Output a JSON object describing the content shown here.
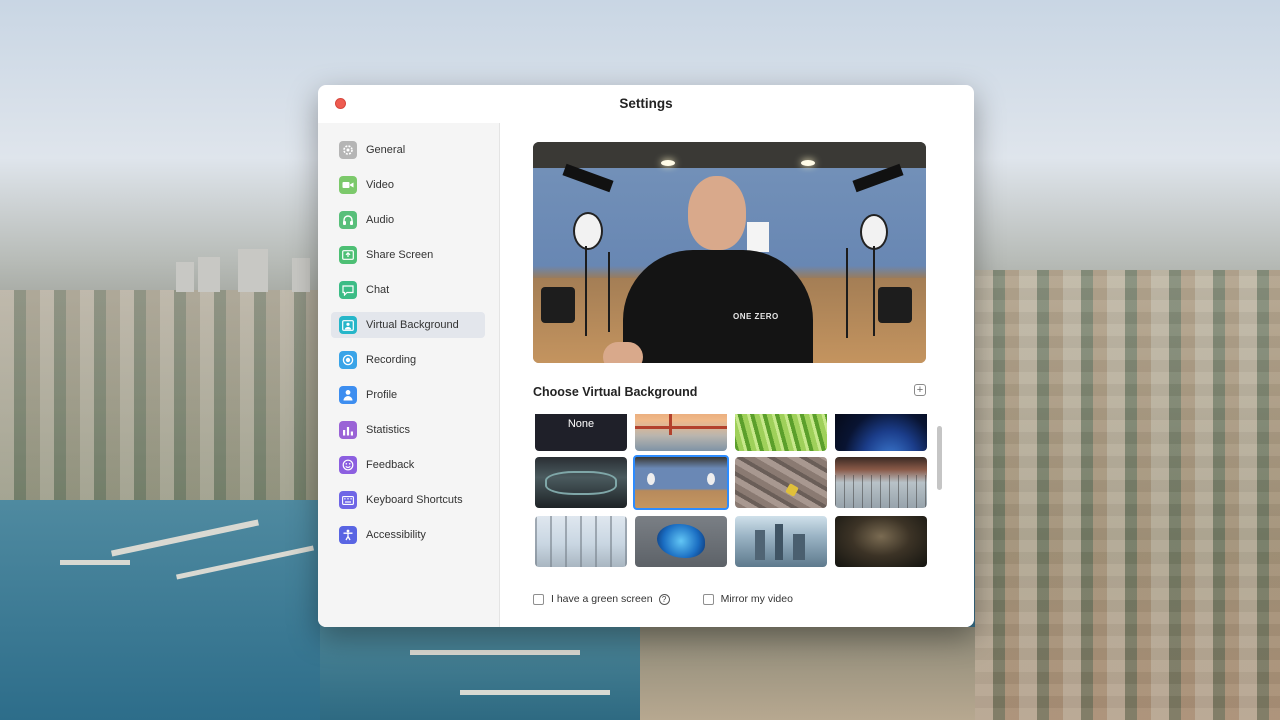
{
  "window": {
    "title": "Settings"
  },
  "sidebar": {
    "items": [
      {
        "label": "General",
        "icon": "gear-icon",
        "color": "#b5b5b5"
      },
      {
        "label": "Video",
        "icon": "video-camera-icon",
        "color": "#7cc96b"
      },
      {
        "label": "Audio",
        "icon": "headphones-icon",
        "color": "#58bf7a"
      },
      {
        "label": "Share Screen",
        "icon": "share-screen-icon",
        "color": "#4dbf74"
      },
      {
        "label": "Chat",
        "icon": "chat-bubble-icon",
        "color": "#3cbc86"
      },
      {
        "label": "Virtual Background",
        "icon": "virtual-background-icon",
        "color": "#26b6c9",
        "active": true
      },
      {
        "label": "Recording",
        "icon": "record-icon",
        "color": "#3aa4e8"
      },
      {
        "label": "Profile",
        "icon": "person-icon",
        "color": "#3d8ef0"
      },
      {
        "label": "Statistics",
        "icon": "bar-chart-icon",
        "color": "#9a63d6"
      },
      {
        "label": "Feedback",
        "icon": "smiley-icon",
        "color": "#8c5fe0"
      },
      {
        "label": "Keyboard Shortcuts",
        "icon": "keyboard-icon",
        "color": "#6f66e6"
      },
      {
        "label": "Accessibility",
        "icon": "accessibility-icon",
        "color": "#5965e3"
      }
    ]
  },
  "main": {
    "section_title": "Choose Virtual Background",
    "none_label": "None",
    "shirt_text": "ONE ZERO",
    "add_icon": "plus-icon",
    "green_screen_label": "I have a green screen",
    "mirror_label": "Mirror my video",
    "help_icon": "question-mark-icon"
  },
  "colors": {
    "accent": "#2d8cff",
    "close": "#ee5b50"
  }
}
